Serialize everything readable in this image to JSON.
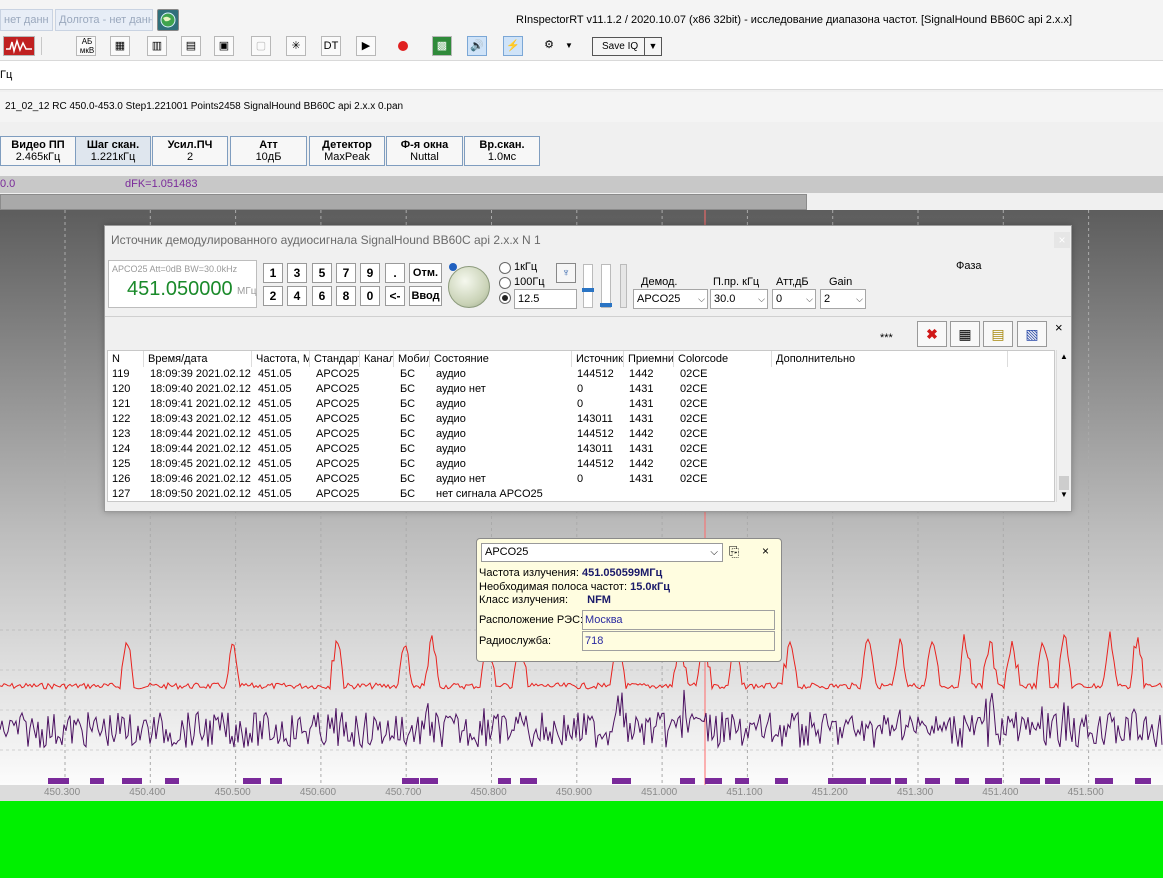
{
  "topbar": {
    "lat_box": "нет данн",
    "lon_box": "Долгота - нет данн",
    "app_title": "RInspectorRT v11.1.2 / 2020.10.07 (x86 32bit) - исследование диапазона частот. [SignalHound BB60C api 2.x.x]",
    "globe_icon": "globe-icon"
  },
  "toolbar": {
    "ab_label": "AБ",
    "ab_sub": "мкВ",
    "dt_label": "DT",
    "saveiq_label": "Save IQ"
  },
  "row3": {
    "unit": "Гц"
  },
  "row4": {
    "file_info": "21_02_12 RC 450.0-453.0 Step1.221001 Points2458 SignalHound BB60C api 2.x.x 0.pan"
  },
  "params": [
    {
      "title": "Видео ПП",
      "value": "2.465кГц"
    },
    {
      "title": "Шаг скан.",
      "value": "1.221кГц"
    },
    {
      "title": "Усил.ПЧ",
      "value": "2"
    },
    {
      "title": "Атт",
      "value": "10дБ"
    },
    {
      "title": "Детектор",
      "value": "MaxPeak"
    },
    {
      "title": "Ф-я окна",
      "value": "Nuttal"
    },
    {
      "title": "Вр.скан.",
      "value": "1.0мс"
    }
  ],
  "spectrum": {
    "top_left": "0.0",
    "dfk": "dFK=1.051483",
    "axis_ticks": [
      "450.300",
      "450.400",
      "450.500",
      "450.600",
      "450.700",
      "450.800",
      "450.900",
      "451.000",
      "451.100",
      "451.200",
      "451.300",
      "451.400",
      "451.500"
    ],
    "red_color": "#e8221e",
    "purple_color": "#4a1060",
    "marker_color": "#7a2a9a",
    "waterfall_color": "#00f000"
  },
  "dialog": {
    "title": "Источник демодулированного аудиосигнала SignalHound BB60C api 2.x.x N 1",
    "close": "×",
    "small_info": "APCO25 Att=0dB BW=30.0kHz",
    "frequency": "451.050000",
    "freq_unit": "МГц",
    "keypad_row1": [
      "1",
      "3",
      "5",
      "7",
      "9",
      "."
    ],
    "keypad_row2": [
      "2",
      "4",
      "6",
      "8",
      "0",
      "<-"
    ],
    "btn_cancel": "Отм.",
    "btn_enter": "Ввод",
    "radio_1k": "1кГц",
    "radio_100": "100Гц",
    "step_value": "12.5",
    "demod_label": "Демод.",
    "demod_value": "APCO25",
    "bw_label": "П.пр. кГц",
    "bw_value": "30.0",
    "att_label": "Атт,дБ",
    "att_value": "0",
    "gain_label": "Gain",
    "gain_value": "2",
    "phase_label": "Фаза",
    "stars": "***",
    "bar_close": "×",
    "columns": [
      "N",
      "Время/дата",
      "Частота, МГц",
      "Стандарт",
      "Канал",
      "Мобил",
      "Состояние",
      "Источник",
      "Приемник",
      "Colorcode",
      "Дополнительно"
    ],
    "rows": [
      [
        "119",
        "18:09:39 2021.02.12",
        "451.05",
        "APCO25",
        "",
        "БС",
        "аудио",
        "144512",
        "1442",
        "02CE",
        ""
      ],
      [
        "120",
        "18:09:40 2021.02.12",
        "451.05",
        "APCO25",
        "",
        "БС",
        "аудио нет",
        "0",
        "1431",
        "02CE",
        ""
      ],
      [
        "121",
        "18:09:41 2021.02.12",
        "451.05",
        "APCO25",
        "",
        "БС",
        "аудио",
        "0",
        "1431",
        "02CE",
        ""
      ],
      [
        "122",
        "18:09:43 2021.02.12",
        "451.05",
        "APCO25",
        "",
        "БС",
        "аудио",
        "143011",
        "1431",
        "02CE",
        ""
      ],
      [
        "123",
        "18:09:44 2021.02.12",
        "451.05",
        "APCO25",
        "",
        "БС",
        "аудио",
        "144512",
        "1442",
        "02CE",
        ""
      ],
      [
        "124",
        "18:09:44 2021.02.12",
        "451.05",
        "APCO25",
        "",
        "БС",
        "аудио",
        "143011",
        "1431",
        "02CE",
        ""
      ],
      [
        "125",
        "18:09:45 2021.02.12",
        "451.05",
        "APCO25",
        "",
        "БС",
        "аудио",
        "144512",
        "1442",
        "02CE",
        ""
      ],
      [
        "126",
        "18:09:46 2021.02.12",
        "451.05",
        "APCO25",
        "",
        "БС",
        "аудио нет",
        "0",
        "1431",
        "02CE",
        ""
      ],
      [
        "127",
        "18:09:50 2021.02.12",
        "451.05",
        "APCO25",
        "",
        "БС",
        "нет сигнала  APCO25",
        "",
        "",
        "",
        ""
      ]
    ]
  },
  "popup": {
    "standard": "APCO25",
    "close": "×",
    "freq_label": "Частота излучения:",
    "freq_value": "451.050599МГц",
    "bw_label": "Необходимая полоса частот:",
    "bw_value": "15.0кГц",
    "class_label": "Класс излучения:",
    "class_value": "NFM",
    "loc_label": "Расположение РЭС:",
    "loc_value": "Москва",
    "service_label": "Радиослужба:",
    "service_value": "718"
  }
}
